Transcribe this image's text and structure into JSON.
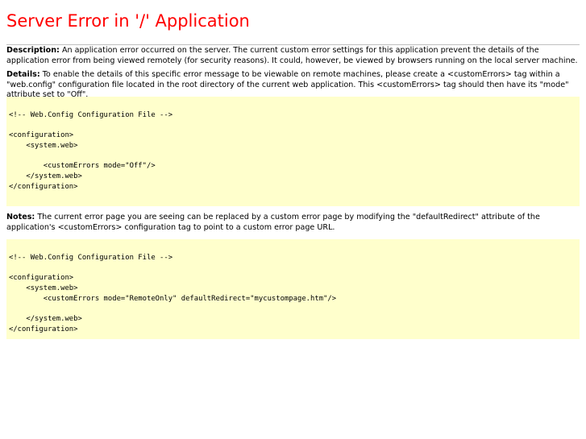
{
  "page": {
    "title": "Server Error in '/' Application"
  },
  "description": {
    "label": "Description:",
    "text": " An application error occurred on the server. The current custom error settings for this application prevent the details of the application error from being viewed remotely (for security reasons). It could, however, be viewed by browsers running on the local server machine."
  },
  "details": {
    "label": "Details:",
    "text": " To enable the details of this specific error message to be viewable on remote machines, please create a <customErrors> tag within a \"web.config\" configuration file located in the root directory of the current web application. This <customErrors> tag should then have its \"mode\" attribute set to \"Off\"."
  },
  "code1": {
    "lines": [
      "<!-- Web.Config Configuration File -->",
      "",
      "<configuration>",
      "    <system.web>",
      "",
      "        <customErrors mode=\"Off\"/>",
      "    </system.web>",
      "</configuration>"
    ]
  },
  "notes": {
    "label": "Notes:",
    "text": " The current error page you are seeing can be replaced by a custom error page by modifying the \"defaultRedirect\" attribute of the application's <customErrors> configuration tag to point to a custom error page URL."
  },
  "code2": {
    "lines": [
      "<!-- Web.Config Configuration File -->",
      "",
      "<configuration>",
      "    <system.web>",
      "        <customErrors mode=\"RemoteOnly\" defaultRedirect=\"mycustompage.htm\"/>",
      "",
      "    </system.web>",
      "</configuration>"
    ]
  },
  "colors": {
    "title": "#ff0000",
    "code_background": "#ffffcc",
    "rule": "#c0c0c0"
  }
}
